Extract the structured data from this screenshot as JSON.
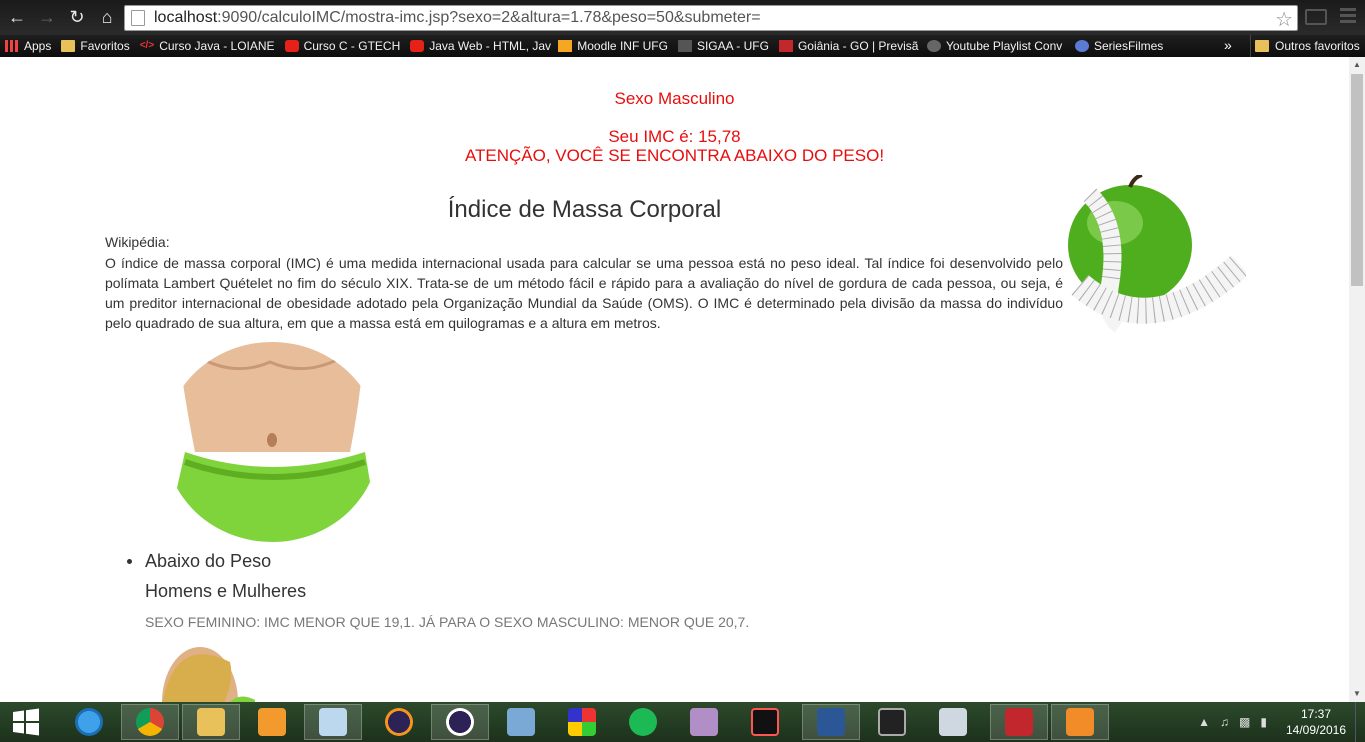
{
  "browser": {
    "url_host": "localhost",
    "url_rest": ":9090/calculoIMC/mostra-imc.jsp?sexo=2&altura=1.78&peso=50&submeter=",
    "bookmarks": [
      {
        "label": "Apps",
        "icon": "apps-icon"
      },
      {
        "label": "Favoritos",
        "icon": "folder-icon"
      },
      {
        "label": "Curso Java - LOIANE",
        "icon": "code-icon"
      },
      {
        "label": "Curso C - GTECH",
        "icon": "youtube-icon"
      },
      {
        "label": "Java Web - HTML, Jav",
        "icon": "youtube-icon"
      },
      {
        "label": "Moodle INF UFG",
        "icon": "moodle-icon"
      },
      {
        "label": "SIGAA - UFG",
        "icon": "document-icon"
      },
      {
        "label": "Goiânia - GO | Previsã",
        "icon": "weather-icon"
      },
      {
        "label": "Youtube Playlist Conv",
        "icon": "music-icon"
      },
      {
        "label": "SeriesFilmes",
        "icon": "series-icon"
      }
    ],
    "more_label": "»",
    "other_bookmarks": "Outros favoritos"
  },
  "page": {
    "sexo": "Sexo Masculino",
    "imc": "Seu IMC é: 15,78",
    "atencao": "ATENÇÃO, VOCÊ SE ENCONTRA ABAIXO DO PESO!",
    "title": "Índice de Massa Corporal",
    "wiki_label": "Wikipédia:",
    "wiki_text": "O índice de massa corporal (IMC) é uma medida internacional usada para calcular se uma pessoa está no peso ideal. Tal índice foi desenvolvido pelo polímata Lambert Quételet no fim do século XIX. Trata-se de um método fácil e rápido para a avaliação do nível de gordura de cada pessoa, ou seja, é um preditor internacional de obesidade adotado pela Organização Mundial da Saúde (OMS). O IMC é determinado pela divisão da massa do indivíduo pelo quadrado de sua altura, em que a massa está em quilogramas e a altura em metros.",
    "categoria": "Abaixo do Peso",
    "grupo": "Homens e Mulheres",
    "criterio": "SEXO FEMININO: IMC MENOR QUE 19,1. JÁ PARA O SEXO MASCULINO: MENOR QUE 20,7."
  },
  "taskbar": {
    "apps": [
      "internet-explorer-icon",
      "chrome-icon",
      "file-explorer-icon",
      "media-player-icon",
      "notepad-icon",
      "eclipse-icon",
      "eclipse-icon",
      "virtualbox-icon",
      "app-grid-icon",
      "spotify-icon",
      "android-studio-icon",
      "intellij-icon",
      "word-icon",
      "terminal-icon",
      "calculator-icon",
      "acrobat-icon",
      "pdf-creator-icon"
    ],
    "time": "17:37",
    "date": "14/09/2016"
  },
  "colors": {
    "alert": "#e80d0d",
    "taskbar": "#2c4a2b"
  }
}
